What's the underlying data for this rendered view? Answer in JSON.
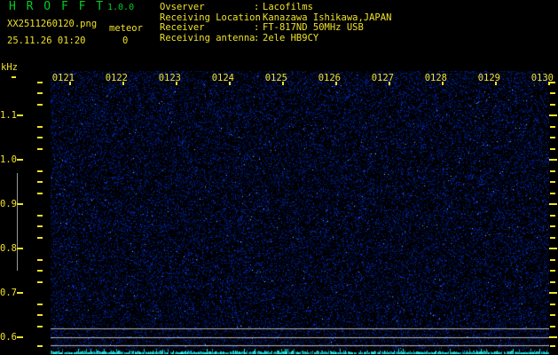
{
  "colors": {
    "green": "#00cc22",
    "yellow": "#f0e228",
    "cyan": "#00e0e0",
    "gray": "#b4b4b4"
  },
  "header": {
    "app_title": "H R O F F T",
    "version": "1.0.0",
    "filename": "XX2511260120.png",
    "mode": "meteor",
    "datetime": "25.11.26 01:20",
    "count": "0",
    "separator": ":",
    "info": [
      {
        "label": "Ovserver",
        "value": "Lacofilms"
      },
      {
        "label": "Receiving Location",
        "value": "Kanazawa Ishikawa,JAPAN"
      },
      {
        "label": "Receiver",
        "value": "FT-817ND 50MHz USB"
      },
      {
        "label": "Receiving antenna",
        "value": "2ele HB9CY"
      }
    ]
  },
  "spectrogram": {
    "freq_unit": "kHz",
    "freq_labels": [
      "1.1",
      "1.0",
      "0.9",
      "0.8",
      "0.7",
      "0.6"
    ],
    "time_labels": [
      "0121",
      "0122",
      "0123",
      "0124",
      "0125",
      "0126",
      "0127",
      "0128",
      "0129",
      "0130"
    ]
  }
}
